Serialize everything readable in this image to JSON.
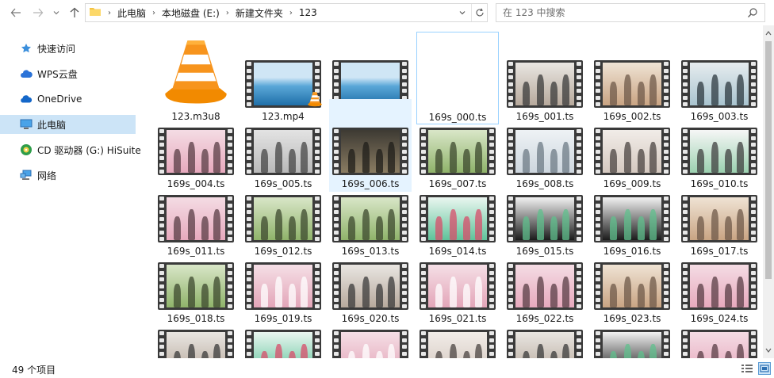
{
  "address": {
    "crumbs": [
      "此电脑",
      "本地磁盘 (E:)",
      "新建文件夹",
      "123"
    ]
  },
  "search": {
    "placeholder": "在 123 中搜索"
  },
  "sidebar": {
    "items": [
      {
        "label": "快速访问",
        "icon": "star-icon"
      },
      {
        "label": "WPS云盘",
        "icon": "wps-cloud-icon"
      },
      {
        "label": "OneDrive",
        "icon": "onedrive-cloud-icon"
      },
      {
        "label": "此电脑",
        "icon": "computer-icon",
        "selected": true
      },
      {
        "label": "CD 驱动器 (G:) HiSuite",
        "icon": "cd-drive-icon"
      },
      {
        "label": "网络",
        "icon": "network-icon"
      }
    ]
  },
  "files": [
    {
      "name": "123.m3u8",
      "kind": "vlc"
    },
    {
      "name": "123.mp4",
      "kind": "video",
      "theme": "ocean",
      "badge": "vlc"
    },
    {
      "name": "123.ts",
      "kind": "video",
      "theme": "ocean"
    },
    {
      "name": "169s_000.ts",
      "kind": "image",
      "theme": "wave"
    },
    {
      "name": "169s_001.ts",
      "kind": "video",
      "theme": "group"
    },
    {
      "name": "169s_002.ts",
      "kind": "video",
      "theme": "warm"
    },
    {
      "name": "169s_003.ts",
      "kind": "video",
      "theme": "studio"
    },
    {
      "name": "169s_004.ts",
      "kind": "video",
      "theme": "pink"
    },
    {
      "name": "169s_005.ts",
      "kind": "video",
      "theme": "grey"
    },
    {
      "name": "169s_006.ts",
      "kind": "video",
      "theme": "night"
    },
    {
      "name": "169s_007.ts",
      "kind": "video",
      "theme": "garden"
    },
    {
      "name": "169s_008.ts",
      "kind": "video",
      "theme": "snow"
    },
    {
      "name": "169s_009.ts",
      "kind": "video",
      "theme": "hall"
    },
    {
      "name": "169s_010.ts",
      "kind": "video",
      "theme": "board"
    },
    {
      "name": "169s_011.ts",
      "kind": "video",
      "theme": "pink"
    },
    {
      "name": "169s_012.ts",
      "kind": "video",
      "theme": "garden"
    },
    {
      "name": "169s_013.ts",
      "kind": "video",
      "theme": "garden"
    },
    {
      "name": "169s_014.ts",
      "kind": "video",
      "theme": "slide"
    },
    {
      "name": "169s_015.ts",
      "kind": "video",
      "theme": "dance"
    },
    {
      "name": "169s_016.ts",
      "kind": "video",
      "theme": "dance"
    },
    {
      "name": "169s_017.ts",
      "kind": "video",
      "theme": "warm"
    },
    {
      "name": "169s_018.ts",
      "kind": "video",
      "theme": "garden"
    },
    {
      "name": "169s_019.ts",
      "kind": "video",
      "theme": "logo"
    },
    {
      "name": "169s_020.ts",
      "kind": "video",
      "theme": "group"
    },
    {
      "name": "169s_021.ts",
      "kind": "video",
      "theme": "logo"
    },
    {
      "name": "169s_022.ts",
      "kind": "video",
      "theme": "pink"
    },
    {
      "name": "169s_023.ts",
      "kind": "video",
      "theme": "warm"
    },
    {
      "name": "169s_024.ts",
      "kind": "video",
      "theme": "pink"
    },
    {
      "name": "",
      "kind": "video",
      "theme": "group"
    },
    {
      "name": "",
      "kind": "video",
      "theme": "slide"
    },
    {
      "name": "",
      "kind": "video",
      "theme": "logo"
    },
    {
      "name": "",
      "kind": "video",
      "theme": "hall"
    },
    {
      "name": "",
      "kind": "video",
      "theme": "group"
    },
    {
      "name": "",
      "kind": "video",
      "theme": "dance"
    },
    {
      "name": "",
      "kind": "video",
      "theme": "pink"
    }
  ],
  "status": {
    "item_count": "49 个项目"
  },
  "colors": {
    "selection": "#cce4f7",
    "hover": "#e5f3ff",
    "vlc_orange": "#f28a00"
  }
}
